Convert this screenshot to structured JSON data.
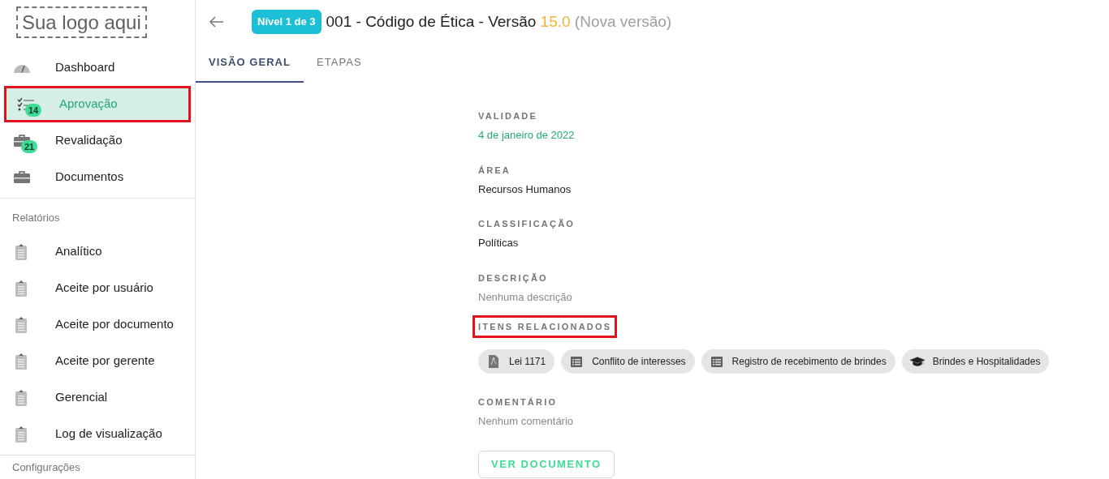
{
  "sidebar": {
    "logo": "Sua logo aqui",
    "items": [
      {
        "label": "Dashboard",
        "kind": "gauge",
        "selected": false,
        "highlighted": false
      },
      {
        "label": "Aprovação",
        "kind": "checklist",
        "badge": "14",
        "selected": true,
        "highlighted": true
      },
      {
        "label": "Revalidação",
        "kind": "briefcase",
        "badge": "21",
        "selected": false,
        "highlighted": false
      },
      {
        "label": "Documentos",
        "kind": "briefcase",
        "selected": false,
        "highlighted": false
      }
    ],
    "sections": [
      {
        "title": "Relatórios",
        "items": [
          {
            "label": "Analítico"
          },
          {
            "label": "Aceite por usuário"
          },
          {
            "label": "Aceite por documento"
          },
          {
            "label": "Aceite por gerente"
          },
          {
            "label": "Gerencial"
          },
          {
            "label": "Log de visualização"
          }
        ]
      },
      {
        "title": "Configurações"
      }
    ]
  },
  "header": {
    "level_badge": "Nível 1 de 3",
    "title": "001 - Código de Ética - Versão",
    "version": "15.0",
    "version_note": "(Nova versão)"
  },
  "tabs": [
    {
      "label": "VISÃO GERAL",
      "selected": true
    },
    {
      "label": "ETAPAS",
      "selected": false
    }
  ],
  "fields": [
    {
      "label": "VALIDADE",
      "value": "4 de janeiro de 2022",
      "kind": "date",
      "highlighted": false
    },
    {
      "label": "ÁREA",
      "value": "Recursos Humanos",
      "kind": "text",
      "highlighted": false
    },
    {
      "label": "CLASSIFICAÇÃO",
      "value": "Políticas",
      "kind": "text",
      "highlighted": false
    },
    {
      "label": "DESCRIÇÃO",
      "value": "Nenhuma descrição",
      "kind": "empty",
      "highlighted": false
    },
    {
      "label": "ITENS RELACIONADOS",
      "kind": "chips",
      "highlighted": true,
      "chips": [
        {
          "label": "Lei 1171",
          "kind": "pdf"
        },
        {
          "label": "Conflito de interesses",
          "kind": "list"
        },
        {
          "label": "Registro de recebimento de brindes",
          "kind": "list"
        },
        {
          "label": "Brindes e Hospitalidades",
          "kind": "cap"
        }
      ]
    },
    {
      "label": "COMENTÁRIO",
      "value": "Nenhum comentário",
      "kind": "empty",
      "highlighted": false
    }
  ],
  "action_button": "VER DOCUMENTO"
}
